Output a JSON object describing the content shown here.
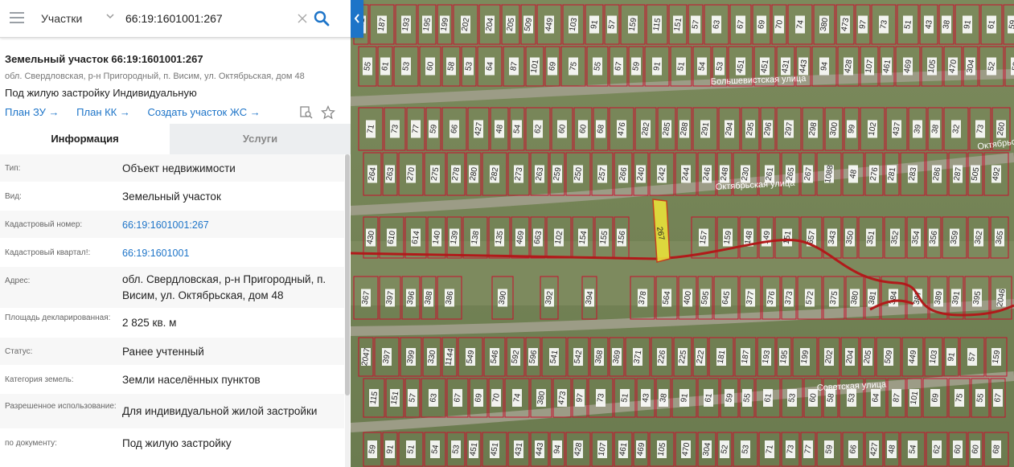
{
  "search": {
    "layer": "Участки",
    "query": "66:19:1601001:267"
  },
  "object": {
    "title": "Земельный участок 66:19:1601001:267",
    "address": "обл. Свердловская, р-н Пригородный, п. Висим, ул. Октябрьская, дом 48",
    "purpose": "Под жилую застройку Индивидуальную"
  },
  "links": {
    "plan_zu": "План ЗУ →",
    "plan_kk": "План КК →",
    "create": "Создать участок ЖС →"
  },
  "icons": {
    "menu": "menu-icon",
    "chevron": "chevron-down-icon",
    "clear": "close-icon",
    "search": "search-icon",
    "collapse": "chevron-left-icon",
    "measure": "search-document-icon",
    "favorite": "star-icon"
  },
  "tabs": {
    "info": "Информация",
    "services": "Услуги"
  },
  "info_rows": [
    {
      "label": "Тип:",
      "value": "Объект недвижимости"
    },
    {
      "label": "Вид:",
      "value": "Земельный участок"
    },
    {
      "label": "Кадастровый номер:",
      "value": "66:19:1601001:267"
    },
    {
      "label": "Кадастровый квартал!:",
      "value": "66:19:1601001"
    },
    {
      "label": "Адрес:",
      "value": "обл. Свердловская, р-н Пригородный, п. Висим, ул. Октябрьская, дом 48"
    },
    {
      "label": "Площадь декларированная:",
      "value": "2 825 кв. м"
    },
    {
      "label": "Статус:",
      "value": "Ранее учтенный"
    },
    {
      "label": "Категория земель:",
      "value": "Земли населённых пунктов"
    },
    {
      "label": "Разрешенное использование:",
      "value": "Для индивидуальной жилой застройки"
    },
    {
      "label": "по документу:",
      "value": "Под жилую застройку"
    }
  ],
  "map": {
    "streets": [
      "Большевистская улица",
      "Октябрьская улица",
      "Советская улица",
      "Октябрьс"
    ],
    "highlighted_parcel": "267",
    "parcels": [
      "181",
      "187",
      "193",
      "195",
      "199",
      "202",
      "204",
      "205",
      "509",
      "449",
      "103",
      "91",
      "57",
      "159",
      "115",
      "151",
      "57",
      "63",
      "67",
      "69",
      "70",
      "74",
      "380",
      "473",
      "97",
      "73",
      "51",
      "43",
      "38",
      "91",
      "61",
      "59",
      "55",
      "61",
      "53",
      "60",
      "58",
      "53",
      "64",
      "87",
      "101",
      "69",
      "75",
      "55",
      "67",
      "59",
      "91",
      "51",
      "54",
      "53",
      "451",
      "451",
      "431",
      "443",
      "94",
      "428",
      "107",
      "461",
      "469",
      "105",
      "470",
      "304",
      "52",
      "53",
      "71",
      "73",
      "77",
      "59",
      "66",
      "427",
      "48",
      "54",
      "62",
      "60",
      "60",
      "68",
      "476",
      "282",
      "285",
      "288",
      "291",
      "294",
      "295",
      "296",
      "297",
      "298",
      "300",
      "99",
      "102",
      "437",
      "39",
      "38",
      "32",
      "73",
      "260",
      "264",
      "263",
      "270",
      "275",
      "278",
      "280",
      "282",
      "273",
      "263",
      "259",
      "250",
      "257",
      "266",
      "240",
      "242",
      "244",
      "246",
      "248",
      "230",
      "261",
      "265",
      "267",
      "1088",
      "48",
      "276",
      "281",
      "283",
      "286",
      "287",
      "505",
      "492",
      "430",
      "610",
      "614",
      "140",
      "139",
      "138",
      "135",
      "469",
      "663",
      "102",
      "154",
      "155",
      "156",
      "157",
      "159",
      "148",
      "149",
      "151",
      "657",
      "343",
      "350",
      "351",
      "352",
      "354",
      "356",
      "359",
      "362",
      "365",
      "367",
      "397",
      "396",
      "388",
      "386",
      "390",
      "392",
      "394",
      "378",
      "564",
      "400",
      "595",
      "645",
      "377",
      "376",
      "373",
      "572",
      "375",
      "380",
      "381",
      "384",
      "387",
      "389",
      "391",
      "395",
      "2046",
      "2047",
      "397",
      "399",
      "330",
      "1144",
      "549",
      "546",
      "592",
      "596",
      "541",
      "542",
      "368",
      "369",
      "371",
      "226",
      "225",
      "222"
    ]
  }
}
